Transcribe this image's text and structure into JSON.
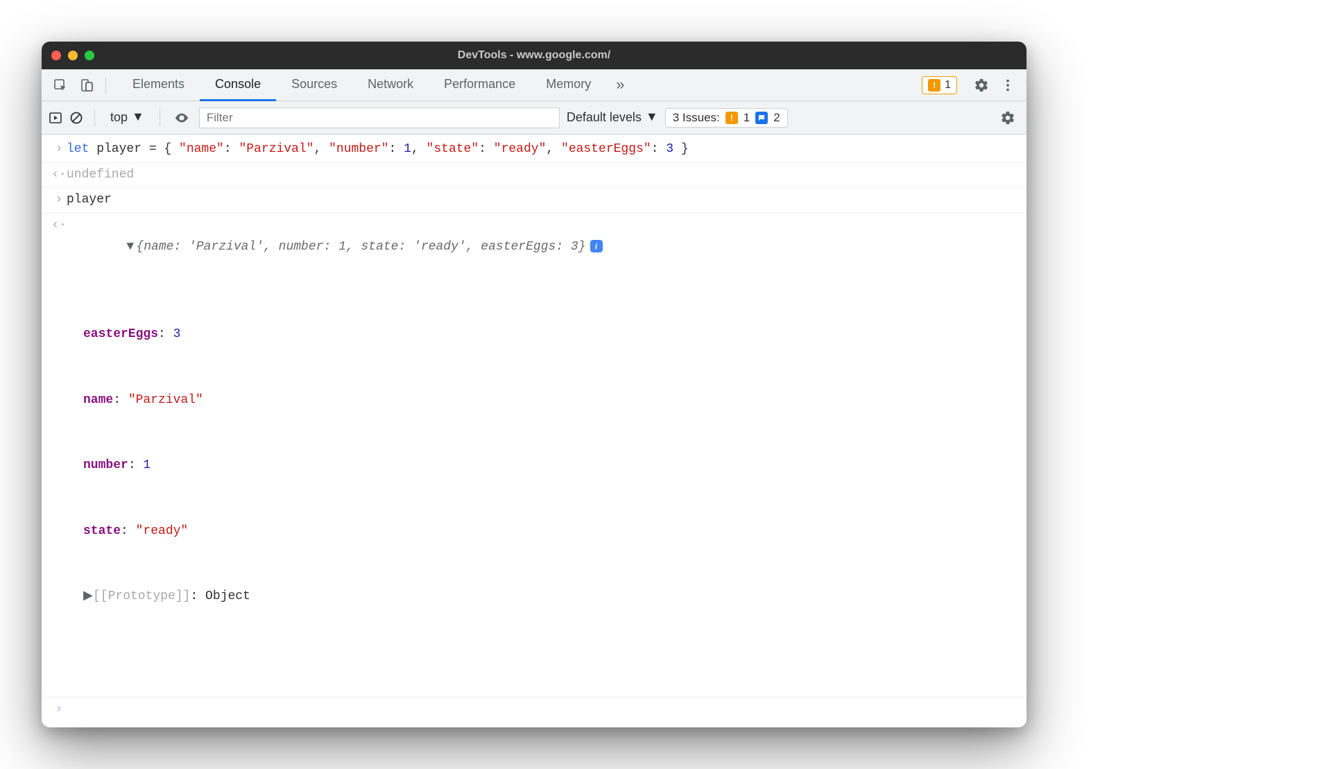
{
  "window": {
    "title": "DevTools - www.google.com/"
  },
  "tabs": {
    "items": [
      "Elements",
      "Console",
      "Sources",
      "Network",
      "Performance",
      "Memory"
    ],
    "active": "Console"
  },
  "warnings_badge": "1",
  "sub_toolbar": {
    "context": "top",
    "filter_placeholder": "Filter",
    "levels": "Default levels",
    "issues_label": "3 Issues:",
    "issues_warn": "1",
    "issues_info": "2"
  },
  "console": {
    "line1_text": "let player = { \"name\": \"Parzival\", \"number\": 1, \"state\": \"ready\", \"easterEggs\": 3 }",
    "line1_kw": "let",
    "line1_ident": " player = { ",
    "line1_k1": "\"name\"",
    "line1_c1": ": ",
    "line1_v1": "\"Parzival\"",
    "line1_s1": ", ",
    "line1_k2": "\"number\"",
    "line1_c2": ": ",
    "line1_v2": "1",
    "line1_s2": ", ",
    "line1_k3": "\"state\"",
    "line1_c3": ": ",
    "line1_v3": "\"ready\"",
    "line1_s3": ", ",
    "line1_k4": "\"easterEggs\"",
    "line1_c4": ": ",
    "line1_v4": "3",
    "line1_end": " }",
    "line2": "undefined",
    "line3": "player",
    "summary": "{name: 'Parzival', number: 1, state: 'ready', easterEggs: 3}",
    "props": {
      "p1k": "easterEggs",
      "p1c": ": ",
      "p1v": "3",
      "p2k": "name",
      "p2c": ": ",
      "p2v": "\"Parzival\"",
      "p3k": "number",
      "p3c": ": ",
      "p3v": "1",
      "p4k": "state",
      "p4c": ": ",
      "p4v": "\"ready\""
    },
    "proto_label": "[[Prototype]]",
    "proto_sep": ": ",
    "proto_val": "Object"
  }
}
